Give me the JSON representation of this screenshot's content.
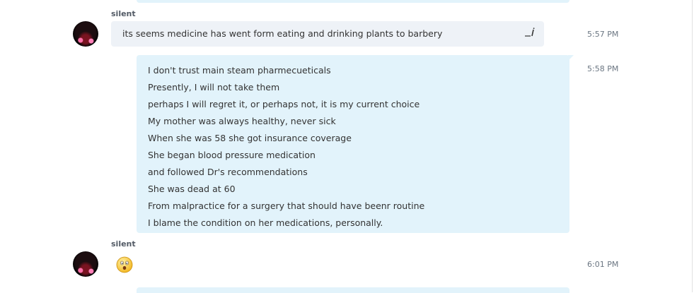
{
  "messages": [
    {
      "sender": "silent",
      "text": "its seems medicine has went form eating and drinking plants to barbery",
      "time": "5:57 PM",
      "edit_icon": "edit-icon"
    },
    {
      "time": "5:58 PM",
      "lines": [
        "I don't trust main steam pharmecueticals",
        "Presently, I will not take them",
        "perhaps I will regret it, or perhaps not, it is my current choice",
        "My mother was always healthy, never sick",
        "When she was 58 she got insurance coverage",
        "She began blood pressure medication",
        "and followed Dr's recommendations",
        "She was dead at 60",
        "From malpractice for a surgery that should have beenr routine",
        "I blame the condition on her medications, personally."
      ]
    },
    {
      "sender": "silent",
      "emoji": "surprised-face-emoji",
      "time": "6:01 PM"
    }
  ],
  "colors": {
    "incoming_bubble": "#eef2f7",
    "outgoing_bubble": "#e2f3fb",
    "timestamp": "#6b7682",
    "sender": "#525a65"
  }
}
